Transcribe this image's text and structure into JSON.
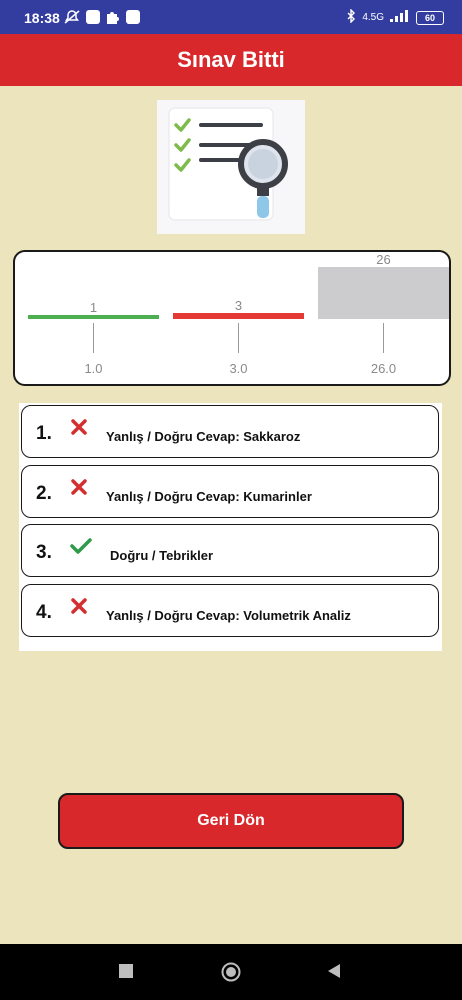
{
  "status_bar": {
    "time": "18:38",
    "network": "4.5G",
    "battery": "60"
  },
  "app_bar": {
    "title": "Sınav Bitti"
  },
  "chart_data": {
    "type": "bar",
    "categories": [
      "1.0",
      "3.0",
      "26.0"
    ],
    "values": [
      1,
      3,
      26
    ],
    "value_labels": [
      "1",
      "3",
      "26"
    ],
    "colors": [
      "#4caf50",
      "#e53935",
      "#cccbcd"
    ],
    "title": "",
    "xlabel": "",
    "ylabel": ""
  },
  "results": [
    {
      "number": "1.",
      "status": "wrong",
      "icon": "cross-icon",
      "text": "Yanlış / Doğru Cevap: Sakkaroz"
    },
    {
      "number": "2.",
      "status": "wrong",
      "icon": "cross-icon",
      "text": "Yanlış / Doğru Cevap: Kumarinler"
    },
    {
      "number": "3.",
      "status": "correct",
      "icon": "check-icon",
      "text": "Doğru / Tebrikler"
    },
    {
      "number": "4.",
      "status": "wrong",
      "icon": "cross-icon",
      "text": "Yanlış / Doğru Cevap: Volumetrik Analiz"
    }
  ],
  "back_button": {
    "label": "Geri Dön"
  },
  "colors": {
    "accent": "#d8282c",
    "status_bar": "#323d9f",
    "background": "#ebe4bc",
    "correct": "#2e9a4a",
    "wrong": "#d32f2f"
  }
}
